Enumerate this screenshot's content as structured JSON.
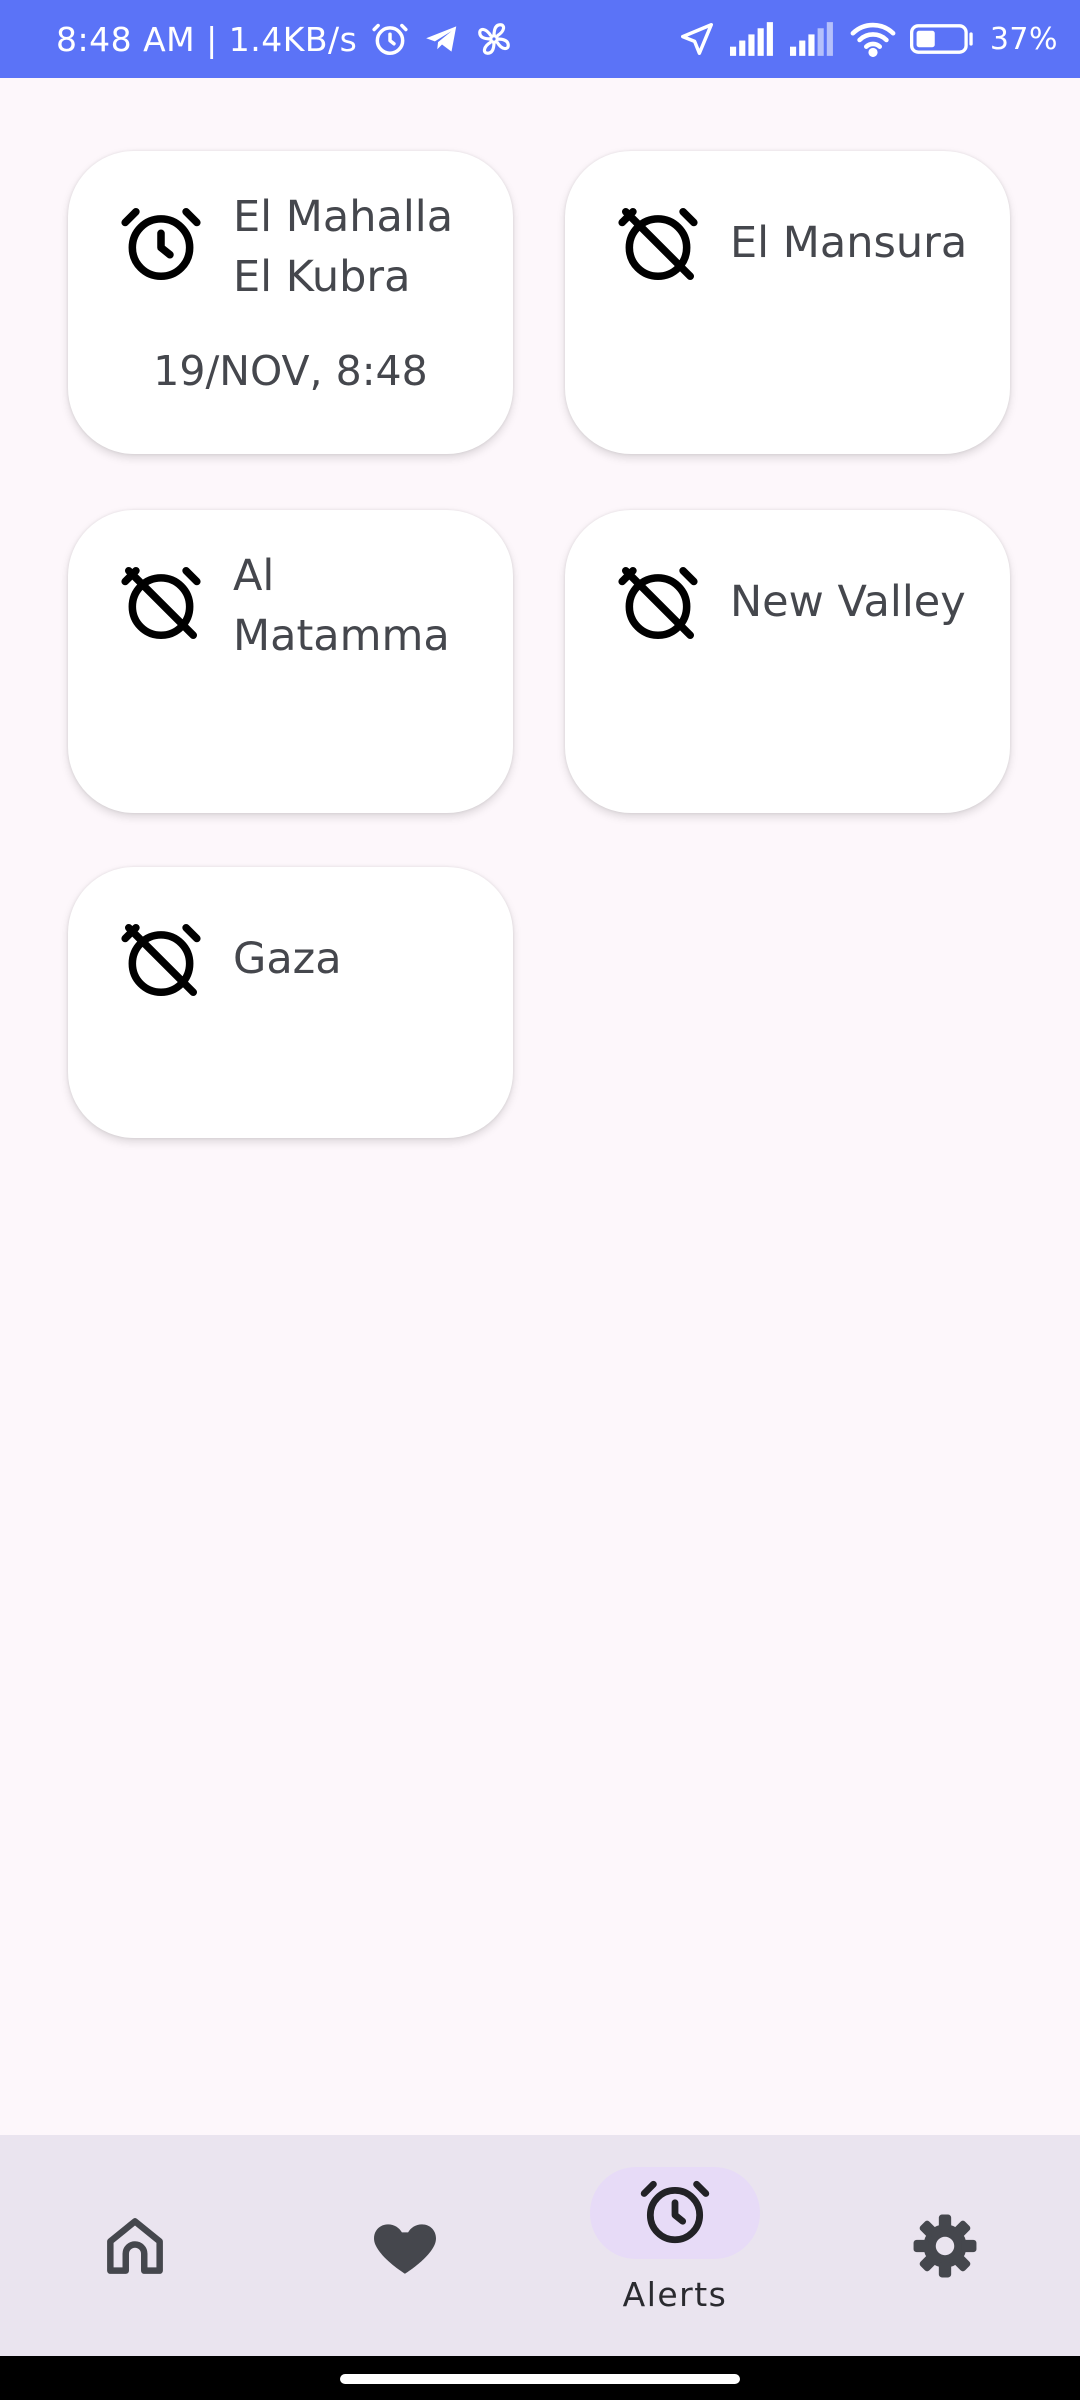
{
  "status_bar": {
    "time_speed": "8:48 AM | 1.4KB/s",
    "battery": "37%",
    "icons": [
      "alarm-icon",
      "telegram-icon",
      "fan-icon",
      "location-arrow-icon",
      "signal-icon",
      "signal-icon",
      "wifi-icon",
      "battery-icon"
    ]
  },
  "alerts": [
    {
      "name": "El Mahalla El Kubra",
      "line1": "El Mahalla",
      "line2": "El Kubra",
      "time": "19/NOV, 8:48",
      "icon": "alarm-icon"
    },
    {
      "name": "El Mansura",
      "icon": "alarm-off-icon"
    },
    {
      "name": "Al Matamma",
      "line1": "Al",
      "line2": "Matamma",
      "icon": "alarm-off-icon"
    },
    {
      "name": "New Valley",
      "icon": "alarm-off-icon"
    },
    {
      "name": "Gaza",
      "icon": "alarm-off-icon"
    }
  ],
  "bottom_nav": {
    "items": [
      {
        "id": "home",
        "icon": "home-icon",
        "label": ""
      },
      {
        "id": "favorites",
        "icon": "heart-icon",
        "label": ""
      },
      {
        "id": "alerts",
        "icon": "alarm-icon",
        "label": "Alerts",
        "active": true
      },
      {
        "id": "settings",
        "icon": "gear-icon",
        "label": ""
      }
    ]
  },
  "colors": {
    "status_bar": "#5b73f7",
    "background": "#fdf7fb",
    "card": "#ffffff",
    "text": "#45474d",
    "nav_background": "#eae4ef",
    "nav_active_pill": "#e7dbf7"
  }
}
